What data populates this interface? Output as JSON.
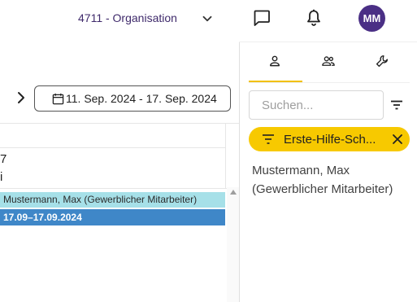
{
  "header": {
    "organisation": "4711 - Organisation",
    "avatar_initials": "MM",
    "avatar_color": "#4a2f85"
  },
  "toolbar": {
    "date_range": "11. Sep. 2024 - 17. Sep. 2024"
  },
  "calendar": {
    "column_day_number": "7",
    "column_day_abbr": "i",
    "event": {
      "name": "Mustermann, Max (Gewerblicher Mitarbeiter)",
      "dates": "17.09–17.09.2024",
      "name_bg": "#a6e0e8",
      "date_bg": "#3f87c8"
    }
  },
  "side_panel": {
    "tabs": [
      {
        "icon": "person-icon"
      },
      {
        "icon": "group-icon"
      },
      {
        "icon": "wrench-icon"
      }
    ],
    "active_tab_color": "#f2c100",
    "search": {
      "placeholder": "Suchen...",
      "value": ""
    },
    "filter_chip": {
      "label": "Erste-Hilfe-Sch...",
      "color": "#f7c900"
    },
    "result": "Mustermann, Max (Gewerblicher Mitarbeiter)"
  }
}
